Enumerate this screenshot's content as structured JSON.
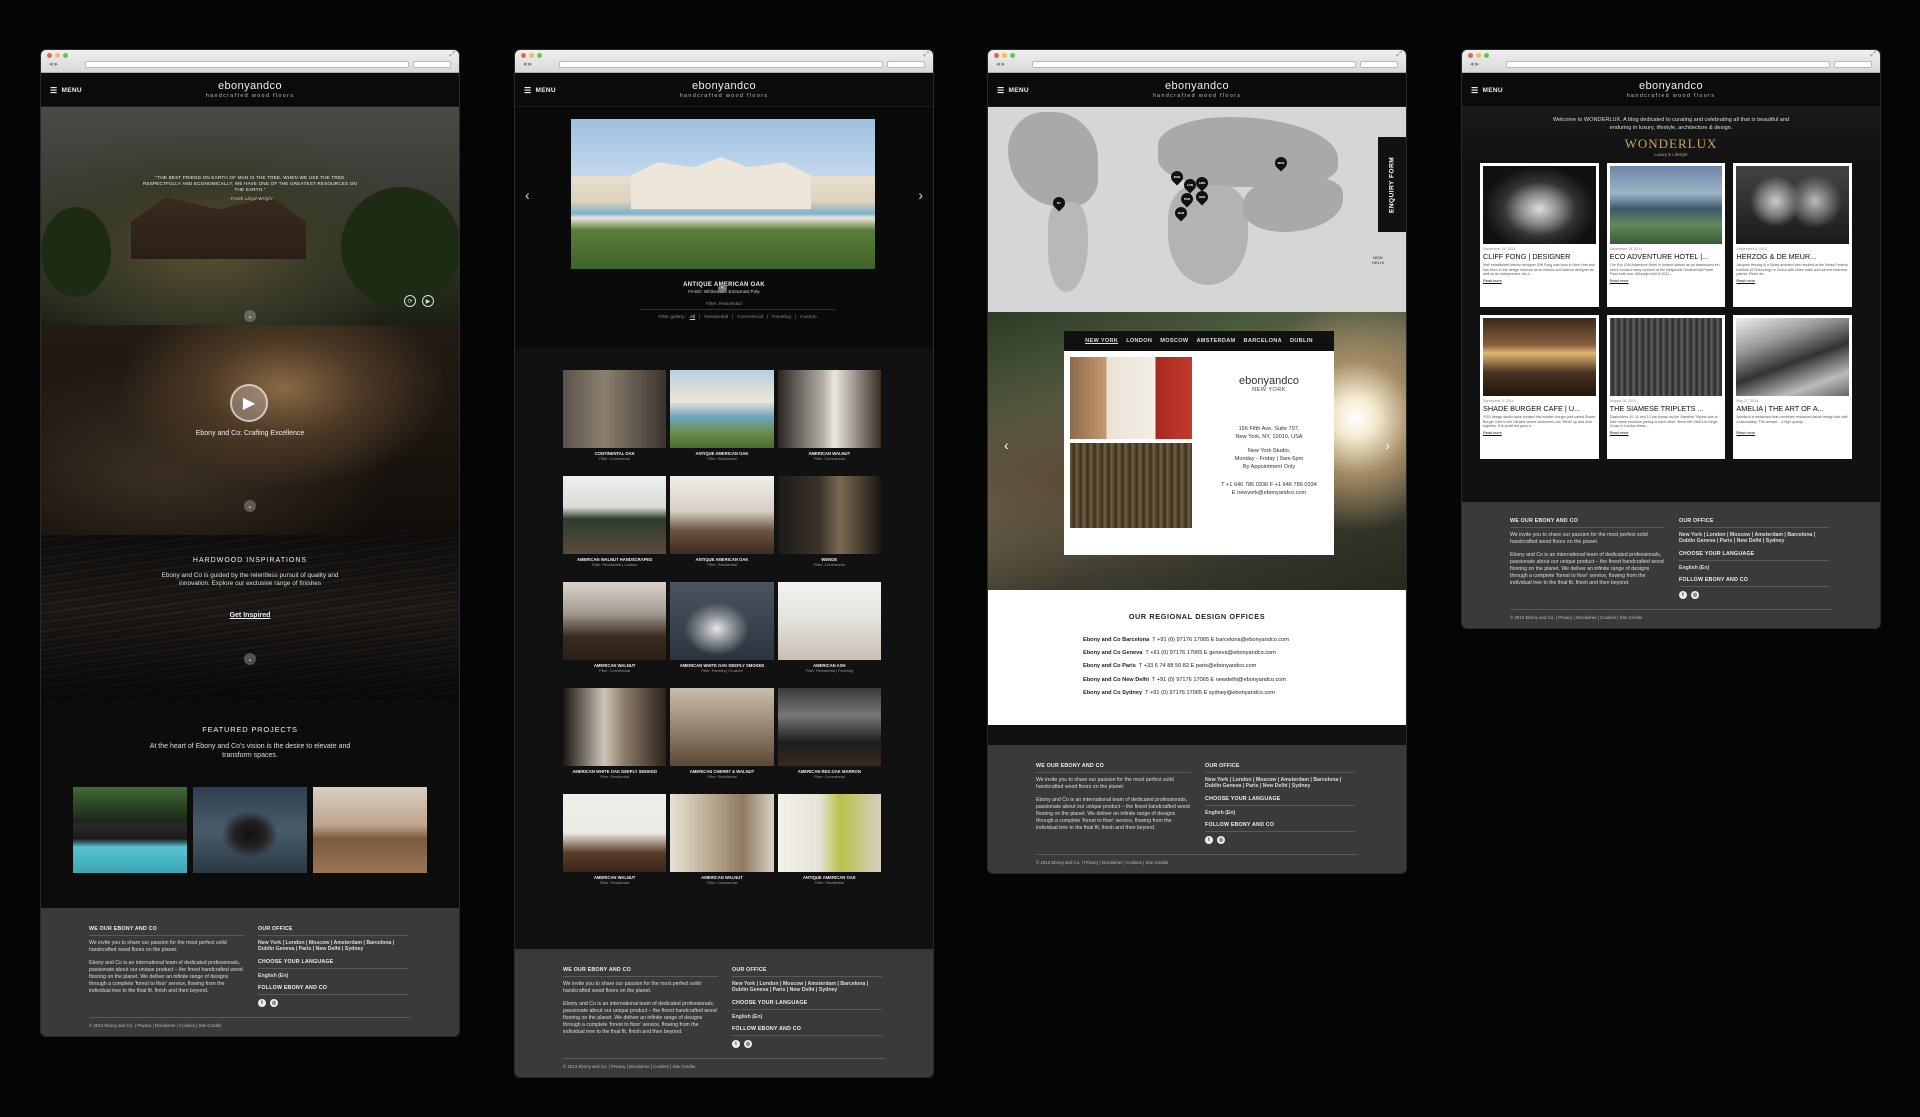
{
  "common": {
    "menu": "MENU",
    "logo_main": "ebonyandco",
    "logo_sub": "handcrafted wood floors",
    "footer": {
      "col1_title": "WE OUR EBONY AND CO",
      "col1_p1": "We invite you to share our passion for the most perfect solid handcrafted wood floors on the planet.",
      "col1_p2": "Ebony and Co is an international team of dedicated professionals, passionate about our unique product – the finest handcrafted wood flooring on the planet. We deliver an infinite range of designs through a complete 'forest to floor' service, flowing from the individual tree to the final fit, finish and then beyond.",
      "office_title": "OUR OFFICE",
      "offices": "New York | London | Moscow | Amsterdam | Barcelona | Dublin Geneva | Paris | New Delhi | Sydney",
      "lang_title": "CHOOSE YOUR LANGUAGE",
      "lang": "English (En)",
      "follow_title": "FOLLOW EBONY AND CO",
      "copyright": "© 2013 Ebony and Co. | Privacy | Disclaimer | Cookies | Site Credits"
    }
  },
  "home": {
    "quote": "\"THE BEST FRIEND ON EARTH OF MAN IS THE TREE. WHEN WE USE THE TREE RESPECTFULLY AND ECONOMICALLY, WE HAVE ONE OF THE GREATEST RESOURCES ON THE EARTH.\"",
    "quote_author": "- Frank Lloyd Wright",
    "video_title": "Ebony and Co: Crafting Excellence",
    "insp_title": "HARDWOOD INSPIRATIONS",
    "insp_text": "Ebony and Co is guided by the relentless pursuit of quality and innovation. Explore our exclusive range of finishes",
    "insp_link": "Get Inspired",
    "featured_title": "FEATURED PROJECTS",
    "featured_text": "At the heart of Ebony and Co's vision is the desire to elevate and transform spaces."
  },
  "gallery": {
    "title": "ANTIQUE AMERICAN OAK",
    "finish": "Finish: Whitewash Extramatt Poly",
    "filter": "Filter: Residential",
    "filter_label": "Filter gallery:",
    "filters": [
      "All",
      "Residential",
      "Commercial",
      "Paneling",
      "Custom"
    ],
    "items": [
      {
        "name": "CONTINENTAL OAK",
        "filter": "Filter: Commercial"
      },
      {
        "name": "ANTIQUE AMERICAN OAK",
        "filter": "Filter: Residential"
      },
      {
        "name": "AMERICAN WALNUT",
        "filter": "Filter: Commercial"
      },
      {
        "name": "AMERICAN WALNUT HANDSCRAPED",
        "filter": "Filter: Residential | Custom"
      },
      {
        "name": "ANTIQUE AMERICAN OAK",
        "filter": "Filter: Residential"
      },
      {
        "name": "WENGE",
        "filter": "Filter: Commercial"
      },
      {
        "name": "AMERICAN WALNUT",
        "filter": "Filter: Commercial"
      },
      {
        "name": "AMERICAN WHITE OAK DEEPLY SMOKED",
        "filter": "Filter: Paneling | Custom"
      },
      {
        "name": "AMERICAN ASH",
        "filter": "Filter: Residential | Paneling"
      },
      {
        "name": "AMERICAN WHITE OAK DEEPLY SMOKED",
        "filter": "Filter: Residential"
      },
      {
        "name": "AMERICAN CHERRY & WALNUT",
        "filter": "Filter: Residential"
      },
      {
        "name": "AMERICAN RED OAK MARRON",
        "filter": "Filter: Commercial"
      },
      {
        "name": "AMERICAN WALNUT",
        "filter": "Filter: Residential"
      },
      {
        "name": "AMERICAN WALNUT",
        "filter": "Filter: Commercial"
      },
      {
        "name": "ANTIQUE AMERICAN OAK",
        "filter": "Filter: Residential"
      }
    ]
  },
  "contact": {
    "enquiry": "ENQUIRY FORM",
    "pins": [
      "NY",
      "DUB",
      "LON",
      "AMS",
      "GEN",
      "PAR",
      "BAR",
      "MOS",
      "NEW DELHI"
    ],
    "tabs": [
      "NEW YORK",
      "LONDON",
      "MOSCOW",
      "AMSTERDAM",
      "BARCELONA",
      "DUBLIN"
    ],
    "card_logo": "ebonyandco",
    "card_city": "NEW YORK",
    "address": [
      "156 Fifth Ave, Suite 707,",
      "New York, NY, 10010, USA",
      "",
      "New York Studio,",
      "Monday - Friday | 9am-5pm",
      "By Appointment Only",
      "",
      "T +1 646 786 0330   F +1 646 786 0334",
      "E newyork@ebonyandco.com"
    ],
    "regional_title": "OUR REGIONAL DESIGN OFFICES",
    "regional": [
      {
        "name": "Ebony and Co Barcelona",
        "detail": "T +91 (0) 97176 17065  E barcelona@ebonyandco.com"
      },
      {
        "name": "Ebony and Co Geneva",
        "detail": "T +91 (0) 97176 17065  E geneva@ebonyandco.com"
      },
      {
        "name": "Ebony and Co Paris",
        "detail": "T +33 6 74 88 50 82  E paris@ebonyandco.com"
      },
      {
        "name": "Ebony and Co New Delhi",
        "detail": "T +91 (0) 97176 17065  E newdelhi@ebonyandco.com"
      },
      {
        "name": "Ebony and Co Sydney",
        "detail": "T +91 (0) 97176 17065  E sydney@ebonyandco.com"
      }
    ]
  },
  "blog": {
    "intro": "Welcome to WONDERLUX. A blog dedicated to curating and celebrating all that is beautiful and enduring in luxury, lifestyle, architecture & design.",
    "logo": "WONDERLUX",
    "logo_sub": "Luxury in Lifestyle",
    "posts": [
      {
        "date": "September 29, 2014",
        "title": "CLIFF FONG | DESIGNER",
        "excerpt": "Well established interior designer Cliff Fong was born in New York and has been in the design industry as an interior and fashion designer as well as an entrepreneur. As a...",
        "more": "Read more"
      },
      {
        "date": "September 18, 2014",
        "title": "ECO ADVENTURE HOTEL |...",
        "excerpt": "The Eco ION Adventure Hotel in Iceland stands as an abandoned inn which housed many workers at the Nesjavellir Geothermal Power Plant built over. Although built in 2011...",
        "more": "Read more"
      },
      {
        "date": "September 8, 2014",
        "title": "HERZOG & DE MEUR...",
        "excerpt": "Jacques Herzog is a Swiss architect who studied at the Swiss Federal Institute of Technology in Zurich with close mate and current business partner Pierre de...",
        "more": "Read more"
      },
      {
        "date": "September 3, 2014",
        "title": "SHADE BURGER CAFE | U...",
        "excerpt": "YOD design studio have created this modern burger joint called Shade Burger Cafe in the Ukraine where customers can \"Meat\" up and dine together. It is small but goes a...",
        "more": "Read more"
      },
      {
        "date": "August 28, 2014",
        "title": "THE SIAMESE TRIPLETS ...",
        "excerpt": "Gasholders 10, 11 and 12 are known as the Siamese Triplets due to their frame structure joining to each other. Since the 1960's in Kings Cross in London these...",
        "more": "Read more"
      },
      {
        "date": "May 27, 2014",
        "title": "AMELIA | THE ART OF A...",
        "excerpt": "Amelia is a restaurant that combines renowned Italian design flair with a fascinating \"The answer... a high quality...",
        "more": "Read more"
      }
    ]
  }
}
